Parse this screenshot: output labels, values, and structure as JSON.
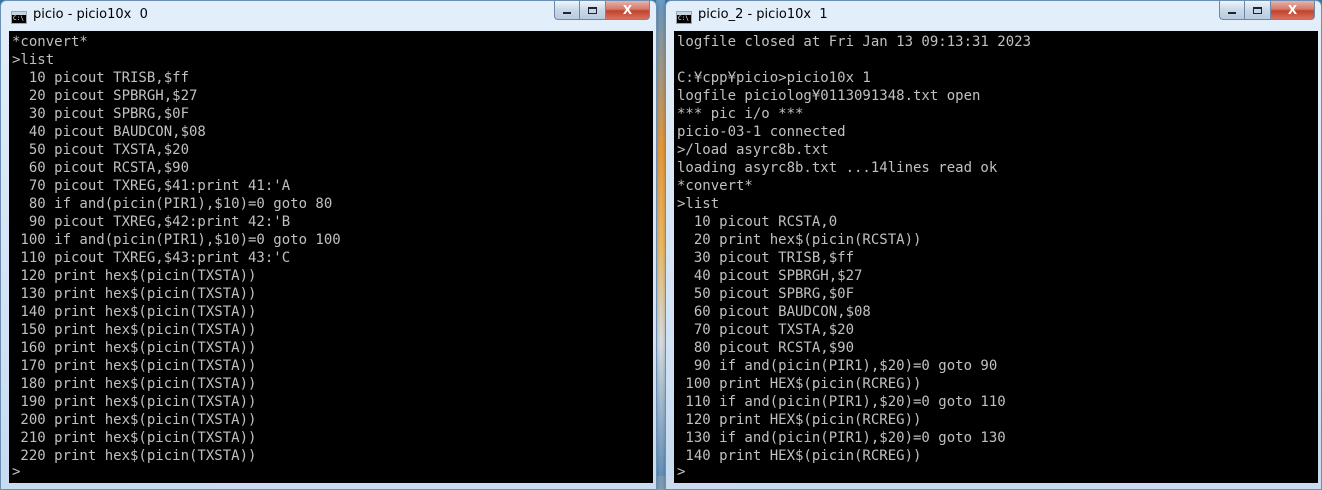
{
  "left_window": {
    "title": "picio - picio10x  0",
    "console_lines": [
      "*convert*",
      ">list",
      "  10 picout TRISB,$ff",
      "  20 picout SPBRGH,$27",
      "  30 picout SPBRG,$0F",
      "  40 picout BAUDCON,$08",
      "  50 picout TXSTA,$20",
      "  60 picout RCSTA,$90",
      "  70 picout TXREG,$41:print 41:'A",
      "  80 if and(picin(PIR1),$10)=0 goto 80",
      "  90 picout TXREG,$42:print 42:'B",
      " 100 if and(picin(PIR1),$10)=0 goto 100",
      " 110 picout TXREG,$43:print 43:'C",
      " 120 print hex$(picin(TXSTA))",
      " 130 print hex$(picin(TXSTA))",
      " 140 print hex$(picin(TXSTA))",
      " 150 print hex$(picin(TXSTA))",
      " 160 print hex$(picin(TXSTA))",
      " 170 print hex$(picin(TXSTA))",
      " 180 print hex$(picin(TXSTA))",
      " 190 print hex$(picin(TXSTA))",
      " 200 print hex$(picin(TXSTA))",
      " 210 print hex$(picin(TXSTA))",
      " 220 print hex$(picin(TXSTA))"
    ],
    "prompt": ">"
  },
  "right_window": {
    "title": "picio_2 - picio10x  1",
    "console_lines": [
      "logfile closed at Fri Jan 13 09:13:31 2023",
      "",
      "C:¥cpp¥picio>picio10x 1",
      "logfile piciolog¥0113091348.txt open",
      "*** pic i/o ***",
      "picio-03-1 connected",
      ">/load asyrc8b.txt",
      "loading asyrc8b.txt ...14lines read ok",
      "*convert*",
      ">list",
      "  10 picout RCSTA,0",
      "  20 print hex$(picin(RCSTA))",
      "  30 picout TRISB,$ff",
      "  40 picout SPBRGH,$27",
      "  50 picout SPBRG,$0F",
      "  60 picout BAUDCON,$08",
      "  70 picout TXSTA,$20",
      "  80 picout RCSTA,$90",
      "  90 if and(picin(PIR1),$20)=0 goto 90",
      " 100 print HEX$(picin(RCREG))",
      " 110 if and(picin(PIR1),$20)=0 goto 110",
      " 120 print HEX$(picin(RCREG))",
      " 130 if and(picin(PIR1),$20)=0 goto 130",
      " 140 print HEX$(picin(RCREG))"
    ],
    "prompt": ">"
  },
  "controls": {
    "close_glyph": "X"
  },
  "colors": {
    "console_bg": "#000000",
    "console_fg": "#c0c0c0"
  },
  "icons": [
    "console-app-icon",
    "minimize-icon",
    "maximize-icon",
    "close-icon"
  ]
}
